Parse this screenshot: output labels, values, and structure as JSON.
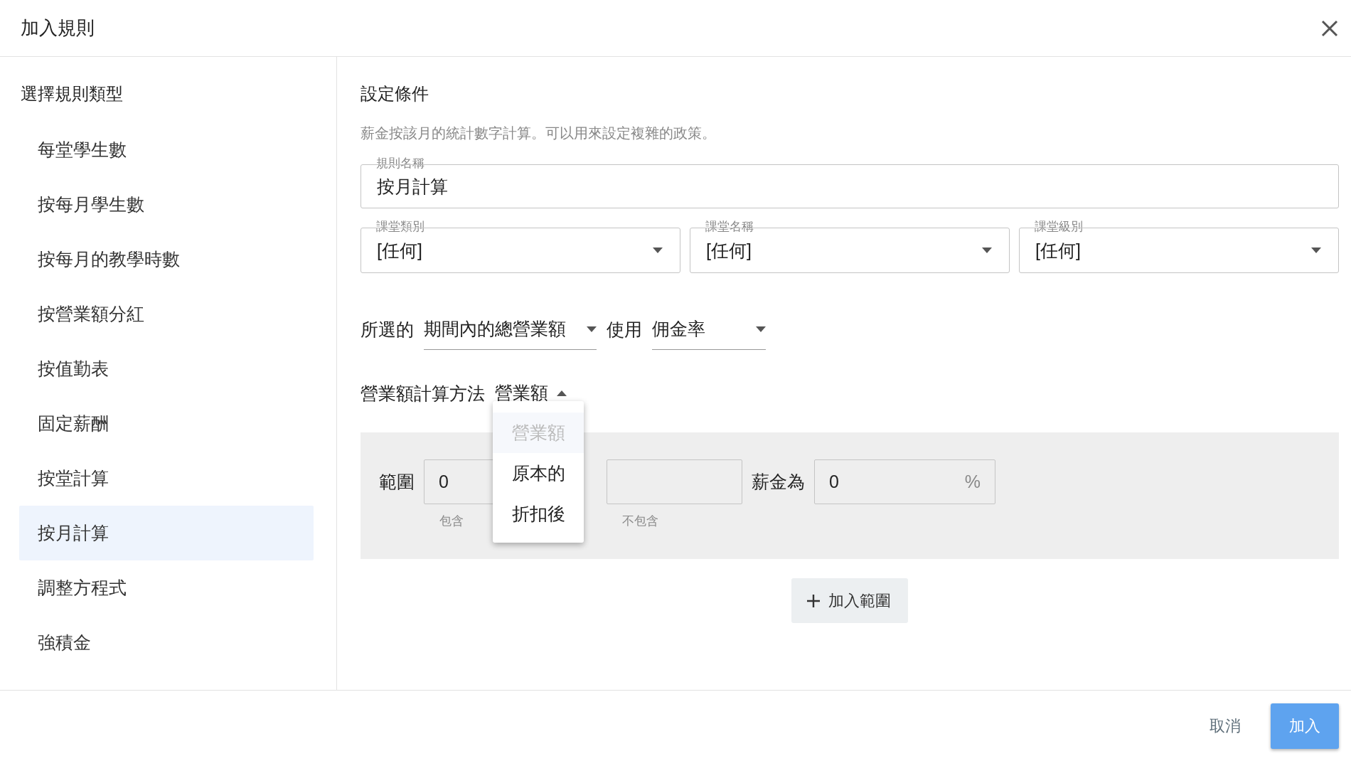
{
  "dialog": {
    "title": "加入規則"
  },
  "sidebar": {
    "heading": "選擇規則類型",
    "items": [
      {
        "label": "每堂學生數",
        "selected": false
      },
      {
        "label": "按每月學生數",
        "selected": false
      },
      {
        "label": "按每月的教學時數",
        "selected": false
      },
      {
        "label": "按營業額分紅",
        "selected": false
      },
      {
        "label": "按值勤表",
        "selected": false
      },
      {
        "label": "固定薪酬",
        "selected": false
      },
      {
        "label": "按堂計算",
        "selected": false
      },
      {
        "label": "按月計算",
        "selected": true
      },
      {
        "label": "調整方程式",
        "selected": false
      },
      {
        "label": "強積金",
        "selected": false
      }
    ]
  },
  "main": {
    "heading": "設定條件",
    "description": "薪金按該月的統計數字計算。可以用來設定複雜的政策。",
    "name_field": {
      "label": "規則名稱",
      "value": "按月計算"
    },
    "selects": [
      {
        "label": "課堂類別",
        "value": "[任何]"
      },
      {
        "label": "課堂名稱",
        "value": "[任何]"
      },
      {
        "label": "課堂級別",
        "value": "[任何]"
      }
    ],
    "statistic_row": [
      {
        "kind": "text",
        "text": "所選的"
      },
      {
        "kind": "select",
        "value": "期間內的總營業額"
      },
      {
        "kind": "text",
        "text": "使用"
      },
      {
        "kind": "select",
        "value": "佣金率"
      }
    ],
    "calc_method": {
      "label": "營業額計算方法",
      "value": "營業額",
      "expanded": true,
      "options": [
        {
          "label": "營業額",
          "selected": true,
          "disabled": true
        },
        {
          "label": "原本的",
          "selected": false,
          "disabled": false
        },
        {
          "label": "折扣後",
          "selected": false,
          "disabled": false
        }
      ]
    },
    "ranges": [
      {
        "label": "範圍",
        "from": "0",
        "from_hint": "包含",
        "to_hint": "不包含",
        "salary_label": "薪金為",
        "salary": "0",
        "unit": "%"
      }
    ],
    "add_range_button": "加入範圍"
  },
  "footer": {
    "cancel": "取消",
    "confirm": "加入"
  }
}
